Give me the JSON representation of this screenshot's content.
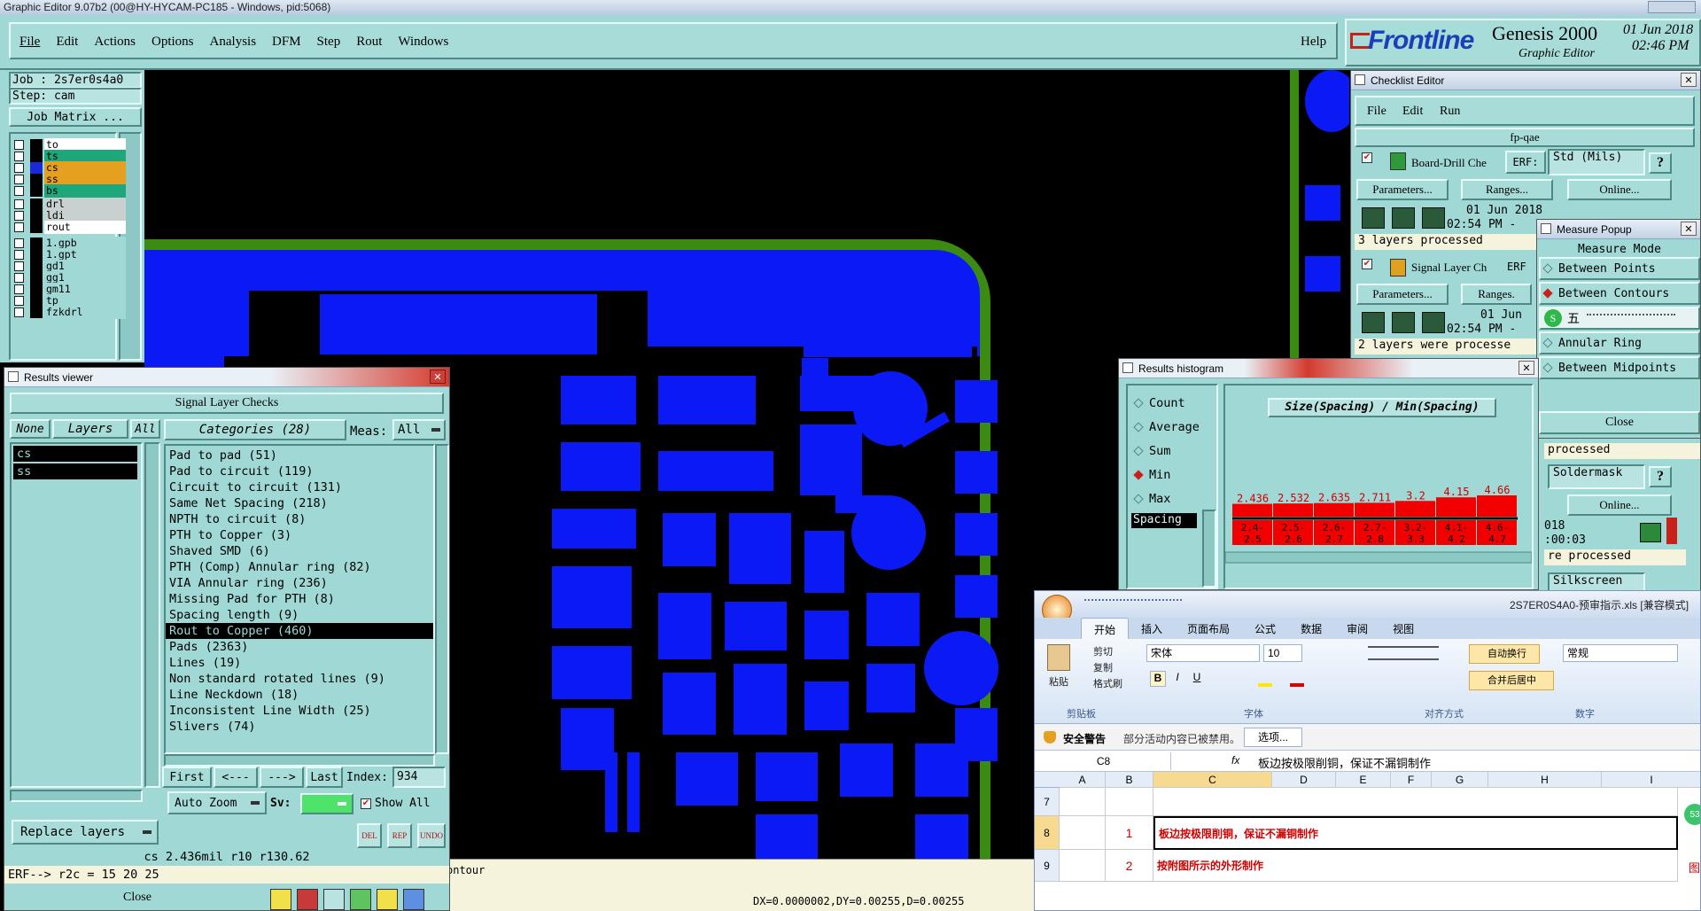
{
  "os_title": "Graphic Editor 9.07b2 (00@HY-HYCAM-PC185 - Windows, pid:5068)",
  "menu": {
    "file": "File",
    "edit": "Edit",
    "actions": "Actions",
    "options": "Options",
    "analysis": "Analysis",
    "dfm": "DFM",
    "step": "Step",
    "rout": "Rout",
    "windows": "Windows",
    "help": "Help"
  },
  "brand": {
    "logo": "Frontline",
    "product": "Genesis 2000",
    "subtitle": "Graphic Editor",
    "date": "01 Jun 2018",
    "time": "02:46 PM"
  },
  "job": {
    "job_label": "Job : 2s7er0s4a0",
    "step_label": "Step: cam",
    "matrix_button": "Job Matrix ..."
  },
  "layers": [
    {
      "name": "to",
      "color": "#ffffff",
      "marker": "⁂"
    },
    {
      "name": "ts",
      "color": "#1fa67a",
      "marker": ""
    },
    {
      "name": "cs",
      "color": "#e6a020",
      "marker": "⁂▫"
    },
    {
      "name": "ss",
      "color": "#e6a020",
      "marker": "⁂"
    },
    {
      "name": "bs",
      "color": "#1fa67a",
      "marker": ""
    },
    {
      "name": "drl",
      "color": "#c8d0d0",
      "marker": ""
    },
    {
      "name": "ldi",
      "color": "#c8d0d0",
      "marker": ""
    },
    {
      "name": "rout",
      "color": "#ffffff",
      "marker": ""
    },
    {
      "name": "1.gpb",
      "color": "#9fd8d4",
      "marker": ""
    },
    {
      "name": "1.gpt",
      "color": "#9fd8d4",
      "marker": ""
    },
    {
      "name": "gd1",
      "color": "#9fd8d4",
      "marker": "⁂"
    },
    {
      "name": "gg1",
      "color": "#9fd8d4",
      "marker": ""
    },
    {
      "name": "gm11",
      "color": "#9fd8d4",
      "marker": "⁂"
    },
    {
      "name": "tp",
      "color": "#9fd8d4",
      "marker": ""
    },
    {
      "name": "fzkdrl",
      "color": "#9fd8d4",
      "marker": ""
    }
  ],
  "results_viewer": {
    "title": "Results viewer",
    "header": "Signal Layer Checks",
    "none_btn": "None",
    "layers_btn": "Layers",
    "all_btn": "All",
    "layer_list": [
      "cs",
      "ss"
    ],
    "categories_btn": "Categories (28)",
    "meas_label": "Meas:",
    "meas_value": "All",
    "categories": [
      "Pad to pad (51)",
      "Pad to circuit (119)",
      "Circuit to circuit (131)",
      "Same Net Spacing (218)",
      "NPTH to circuit (8)",
      "PTH to Copper (3)",
      "Shaved SMD (6)",
      "PTH (Comp) Annular ring (82)",
      "VIA Annular ring (236)",
      "Missing Pad for PTH (8)",
      "Spacing length (9)",
      "Rout to Copper (460)",
      "Pads (2363)",
      "Lines (19)",
      "Non standard rotated lines (9)",
      "Line Neckdown (18)",
      "Inconsistent Line Width (25)",
      "Slivers (74)"
    ],
    "selected_category": "Rout to Copper (460)",
    "first": "First",
    "prev": "<---",
    "next": "--->",
    "last": "Last",
    "index_label": "Index:",
    "index_value": "934",
    "zoom": "Auto Zoom",
    "sv_label": "Sv:",
    "show_all": "Show All",
    "del": "DEL",
    "rep": "REP",
    "undo": "UNDO",
    "replace_layers": "Replace layers",
    "status": "cs 2.436mil  r10  r130.62",
    "erf_line": "ERF--> r2c = 15 20 25",
    "close": "Close"
  },
  "status_bar": {
    "left_text": "ontour",
    "coords": "DX=0.0000002,DY=0.00255,D=0.00255"
  },
  "checklist": {
    "title": "Checklist Editor",
    "file": "File",
    "edit": "Edit",
    "run": "Run",
    "name": "fp-qae",
    "item1": "Board-Drill Che",
    "erf_label": "ERF:",
    "erf_value": "Std (Mils)",
    "params": "Parameters...",
    "ranges": "Ranges...",
    "online": "Online...",
    "date1": "01 Jun 2018",
    "time1": "02:54 PM -",
    "processed1": "3 layers processed",
    "item2": "Signal Layer Ch",
    "erf2": "ERF",
    "ranges2": "Ranges.",
    "date2": "01 Jun",
    "time2": "02:54 PM -",
    "processed2": "2 layers were processe",
    "frag_processed": "processed",
    "soldermask": "Soldermask",
    "online2": "Online...",
    "frag_year": "018",
    "frag_time": ":00:03",
    "frag_processed2": "re processed",
    "silkscreen": "Silkscreen"
  },
  "measure": {
    "title": "Measure Popup",
    "mode": "Measure Mode",
    "opt1": "Between Points",
    "opt2": "Between Contours",
    "opt4": "Annular Ring",
    "opt5": "Between Midpoints",
    "close": "Close",
    "ime": "五"
  },
  "histogram": {
    "title": "Results histogram",
    "radios": [
      "Count",
      "Average",
      "Sum",
      "Min",
      "Max"
    ],
    "selected": "Min",
    "list_item": "Spacing",
    "chart_title": "Size(Spacing) / Min(Spacing)",
    "bins": [
      {
        "label": "2.4-2.5",
        "value": 2.436,
        "text": "2.436"
      },
      {
        "label": "2.5-2.6",
        "value": 2.532,
        "text": "2.532"
      },
      {
        "label": "2.6-2.7",
        "value": 2.635,
        "text": "2.635"
      },
      {
        "label": "2.7-2.8",
        "value": 2.711,
        "text": "2.711"
      },
      {
        "label": "3.2-3.3",
        "value": 3.2,
        "text": "3.2"
      },
      {
        "label": "4.1-4.2",
        "value": 4.15,
        "text": "4.15"
      },
      {
        "label": "4.6-4.7",
        "value": 4.66,
        "text": "4.66"
      }
    ]
  },
  "excel": {
    "title": "2S7ER0S4A0-预审指示.xls [兼容模式]",
    "tabs": [
      "开始",
      "插入",
      "页面布局",
      "公式",
      "数据",
      "审阅",
      "视图"
    ],
    "cut": "剪切",
    "copy": "复制",
    "format_painter": "格式刷",
    "paste": "粘贴",
    "clipboard": "剪贴板",
    "font_name": "宋体",
    "font_size": "10",
    "font_group": "字体",
    "wrap": "自动换行",
    "merge": "合并后居中",
    "align_group": "对齐方式",
    "number_format": "常规",
    "number_group": "数字",
    "security_title": "安全警告",
    "security_msg": "部分活动内容已被禁用。",
    "options_btn": "选项...",
    "cell_ref": "C8",
    "fx": "fx",
    "formula": "板边按极限削铜，保证不漏铜制作",
    "columns": [
      "A",
      "B",
      "C",
      "D",
      "E",
      "F",
      "G",
      "H",
      "I"
    ],
    "rows": [
      {
        "num": "7",
        "b": "",
        "c": ""
      },
      {
        "num": "8",
        "b": "1",
        "c": "板边按极限削铜，保证不漏铜制作"
      },
      {
        "num": "9",
        "b": "2",
        "c": "按附图所示的外形制作"
      }
    ],
    "edge_text": "图",
    "badge": "53"
  }
}
